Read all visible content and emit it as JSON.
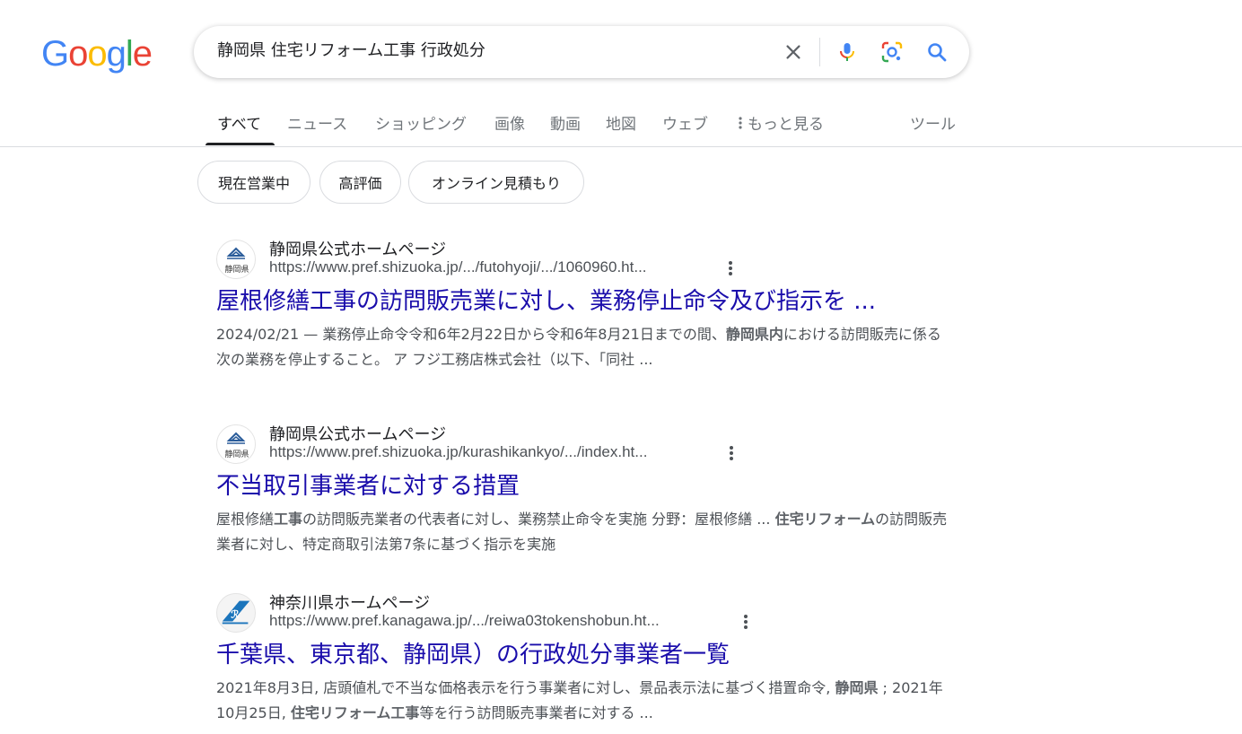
{
  "logo": {
    "letters": [
      "G",
      "o",
      "o",
      "g",
      "l",
      "e"
    ],
    "colors": [
      "#4285F4",
      "#EA4335",
      "#FBBC05",
      "#4285F4",
      "#34A853",
      "#EA4335"
    ]
  },
  "search": {
    "query": "静岡県 住宅リフォーム工事 行政処分"
  },
  "icons": {
    "clear": "close-icon",
    "voice": "microphone-icon",
    "lens": "lens-camera-icon",
    "search": "search-icon"
  },
  "tabs": [
    {
      "label": "すべて",
      "active": true
    },
    {
      "label": "ニュース"
    },
    {
      "label": "ショッピング"
    },
    {
      "label": "画像"
    },
    {
      "label": "動画"
    },
    {
      "label": "地図"
    },
    {
      "label": "ウェブ"
    },
    {
      "label": "もっと見る"
    },
    {
      "label": "ツール"
    }
  ],
  "chips": [
    "現在営業中",
    "高評価",
    "オンライン見積もり"
  ],
  "results": [
    {
      "site": "静岡県公式ホームページ",
      "favicon_text": "静岡県",
      "url": "https://www.pref.shizuoka.jp/.../futohyoji/.../1060960.ht...",
      "title": "屋根修繕工事の訪問販売業に対し、業務停止命令及び指示を ...",
      "snippet_parts": [
        {
          "t": "2024/02/21 — 業務停止命令令和6年2月22日から令和6年8月21日までの間、"
        },
        {
          "t": "静岡県内",
          "b": true
        },
        {
          "t": "における訪問販売に係る次の業務を停止すること。 ア フジ工務店株式会社（以下、「同社 ..."
        }
      ]
    },
    {
      "site": "静岡県公式ホームページ",
      "favicon_text": "静岡県",
      "url": "https://www.pref.shizuoka.jp/kurashikankyo/.../index.ht...",
      "title": "不当取引事業者に対する措置",
      "snippet_parts": [
        {
          "t": "屋根修繕"
        },
        {
          "t": "工事",
          "b": true
        },
        {
          "t": "の訪問販売業者の代表者に対し、業務禁止命令を実施 分野：屋根修繕 ... "
        },
        {
          "t": "住宅リフォーム",
          "b": true
        },
        {
          "t": "の訪問販売業者に対し、特定商取引法第7条に基づく指示を実施"
        }
      ]
    },
    {
      "site": "神奈川県ホームページ",
      "favicon_text": "",
      "url": "https://www.pref.kanagawa.jp/.../reiwa03tokenshobun.ht...",
      "title": "千葉県、東京都、静岡県）の行政処分事業者一覧",
      "snippet_parts": [
        {
          "t": "2021年8月3日, 店頭値札で不当な価格表示を行う事業者に対し、景品表示法に基づく措置命令, "
        },
        {
          "t": "静岡県",
          "b": true
        },
        {
          "t": " ; 2021年10月25日, "
        },
        {
          "t": "住宅リフォーム工事",
          "b": true
        },
        {
          "t": "等を行う訪問販売事業者に対する ..."
        }
      ]
    }
  ]
}
